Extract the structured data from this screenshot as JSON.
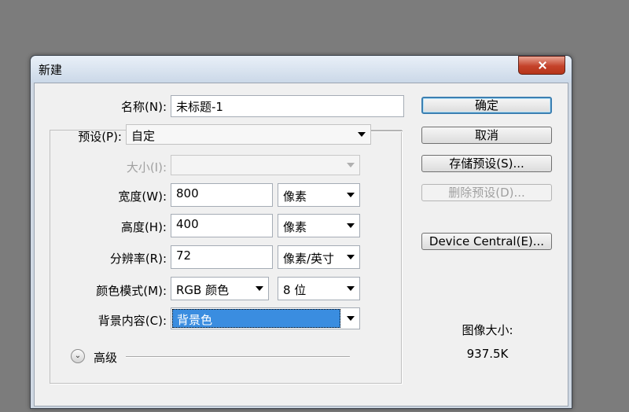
{
  "window": {
    "title": "新建"
  },
  "form": {
    "name_label": "名称(N):",
    "name_value": "未标题-1",
    "preset_label": "预设(P):",
    "preset_value": "自定",
    "size_label": "大小(I):",
    "size_value": "",
    "width_label": "宽度(W):",
    "width_value": "800",
    "width_unit": "像素",
    "height_label": "高度(H):",
    "height_value": "400",
    "height_unit": "像素",
    "resolution_label": "分辨率(R):",
    "resolution_value": "72",
    "resolution_unit": "像素/英寸",
    "color_mode_label": "颜色模式(M):",
    "color_mode_value": "RGB 颜色",
    "bit_depth_value": "8 位",
    "background_label": "背景内容(C):",
    "background_value": "背景色",
    "advanced_label": "高级"
  },
  "buttons": {
    "ok": "确定",
    "cancel": "取消",
    "save_preset": "存储预设(S)...",
    "delete_preset": "删除预设(D)...",
    "device_central": "Device Central(E)..."
  },
  "info": {
    "image_size_label": "图像大小:",
    "image_size_value": "937.5K"
  },
  "colors": {
    "desktop": "#7c7c7c",
    "dialog": "#f0f0f0",
    "selection": "#3a8de0",
    "close_button": "#c4422b"
  },
  "icons": [
    "close-icon",
    "chevron-down-icon",
    "expand-advanced-icon"
  ]
}
